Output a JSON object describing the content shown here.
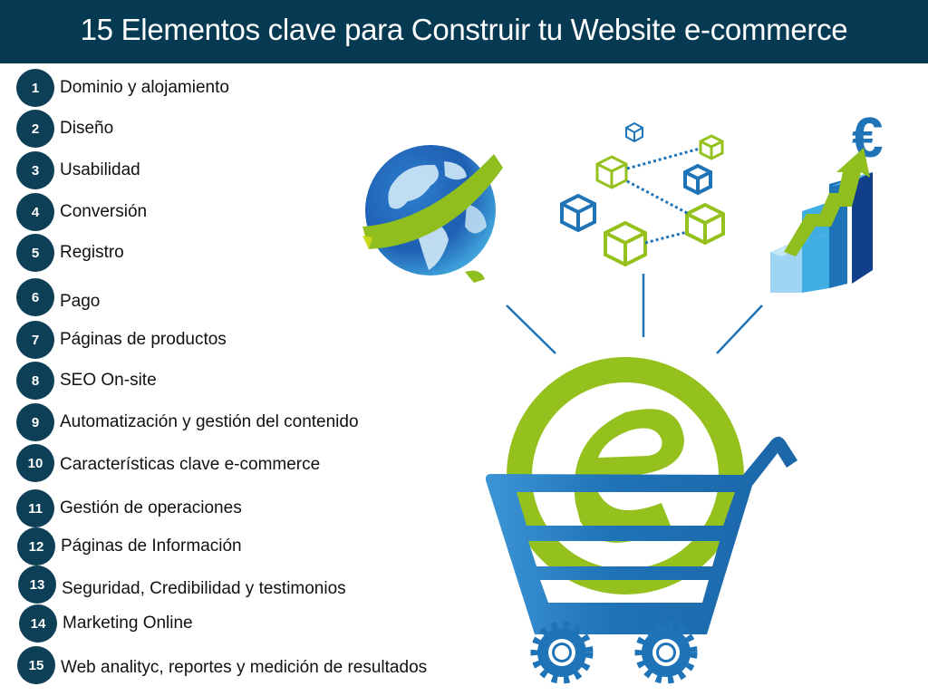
{
  "header": {
    "title": "15 Elementos clave para Construir tu Website e-commerce"
  },
  "colors": {
    "header_bg": "#063a52",
    "badge_bg": "#0d3f56",
    "accent_green": "#95c11f",
    "accent_blue": "#1f73b7"
  },
  "items": [
    {
      "number": "1",
      "label": "Dominio y alojamiento"
    },
    {
      "number": "2",
      "label": "Diseño"
    },
    {
      "number": "3",
      "label": "Usabilidad"
    },
    {
      "number": "4",
      "label": "Conversión"
    },
    {
      "number": "5",
      "label": "Registro"
    },
    {
      "number": "6",
      "label": "Pago"
    },
    {
      "number": "7",
      "label": "Páginas de productos"
    },
    {
      "number": "8",
      "label": "SEO On-site"
    },
    {
      "number": "9",
      "label": "Automatización y gestión del contenido"
    },
    {
      "number": "10",
      "label": "Características clave e-commerce"
    },
    {
      "number": "11",
      "label": "Gestión de operaciones"
    },
    {
      "number": "12",
      "label": "Páginas de Información"
    },
    {
      "number": "13",
      "label": "Seguridad, Credibilidad y testimonios"
    },
    {
      "number": "14",
      "label": "Marketing Online"
    },
    {
      "number": "15",
      "label": "Web analityc, reportes y medición de resultados"
    }
  ],
  "illustration": {
    "currency_symbol": "€",
    "icons": [
      "globe-icon",
      "network-cubes-icon",
      "growth-chart-icon",
      "e-letter-icon",
      "shopping-cart-icon"
    ]
  }
}
